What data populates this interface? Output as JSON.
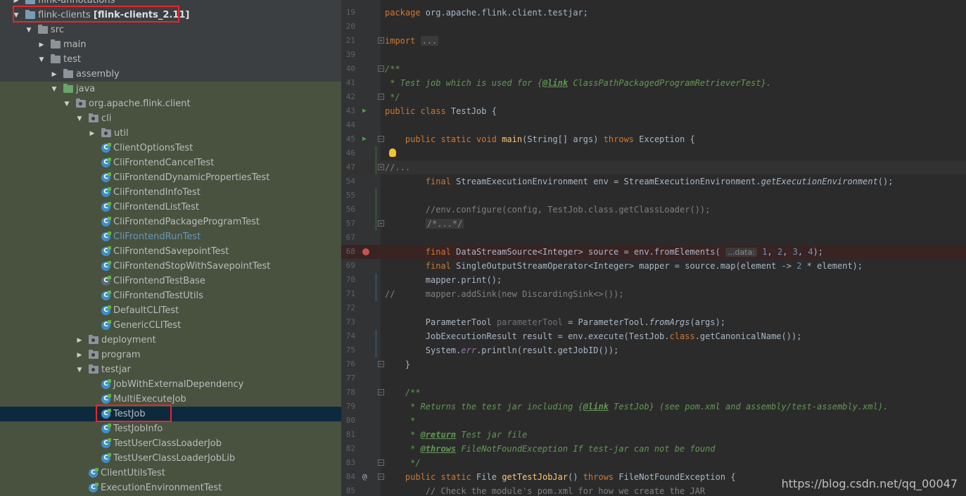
{
  "tree": {
    "items": [
      {
        "label": "flink-annotations",
        "depth": 1,
        "kind": "module",
        "arrow": "right"
      },
      {
        "label": "flink-clients ",
        "suffix": "[flink-clients_2.11]",
        "depth": 1,
        "kind": "module",
        "arrow": "down"
      },
      {
        "label": "src",
        "depth": 2,
        "kind": "folder",
        "arrow": "down"
      },
      {
        "label": "main",
        "depth": 3,
        "kind": "folder",
        "arrow": "right"
      },
      {
        "label": "test",
        "depth": 3,
        "kind": "folder",
        "arrow": "down"
      },
      {
        "label": "assembly",
        "depth": 4,
        "kind": "folder",
        "arrow": "right"
      },
      {
        "label": "java",
        "depth": 4,
        "kind": "testsrc",
        "arrow": "down"
      },
      {
        "label": "org.apache.flink.client",
        "depth": 5,
        "kind": "pkg",
        "arrow": "down"
      },
      {
        "label": "cli",
        "depth": 6,
        "kind": "pkg",
        "arrow": "down"
      },
      {
        "label": "util",
        "depth": 7,
        "kind": "pkg",
        "arrow": "right"
      },
      {
        "label": "ClientOptionsTest",
        "depth": 7,
        "kind": "class",
        "arrow": "none"
      },
      {
        "label": "CliFrontendCancelTest",
        "depth": 7,
        "kind": "class",
        "arrow": "none"
      },
      {
        "label": "CliFrontendDynamicPropertiesTest",
        "depth": 7,
        "kind": "class",
        "arrow": "none"
      },
      {
        "label": "CliFrontendInfoTest",
        "depth": 7,
        "kind": "class",
        "arrow": "none"
      },
      {
        "label": "CliFrontendListTest",
        "depth": 7,
        "kind": "class",
        "arrow": "none"
      },
      {
        "label": "CliFrontendPackageProgramTest",
        "depth": 7,
        "kind": "class",
        "arrow": "none"
      },
      {
        "label": "CliFrontendRunTest",
        "depth": 7,
        "kind": "class",
        "arrow": "none",
        "link": true
      },
      {
        "label": "CliFrontendSavepointTest",
        "depth": 7,
        "kind": "class",
        "arrow": "none"
      },
      {
        "label": "CliFrontendStopWithSavepointTest",
        "depth": 7,
        "kind": "class",
        "arrow": "none"
      },
      {
        "label": "CliFrontendTestBase",
        "depth": 7,
        "kind": "abstract",
        "arrow": "none"
      },
      {
        "label": "CliFrontendTestUtils",
        "depth": 7,
        "kind": "class",
        "arrow": "none"
      },
      {
        "label": "DefaultCLITest",
        "depth": 7,
        "kind": "class",
        "arrow": "none"
      },
      {
        "label": "GenericCLITest",
        "depth": 7,
        "kind": "class",
        "arrow": "none"
      },
      {
        "label": "deployment",
        "depth": 6,
        "kind": "pkg",
        "arrow": "right"
      },
      {
        "label": "program",
        "depth": 6,
        "kind": "pkg",
        "arrow": "right"
      },
      {
        "label": "testjar",
        "depth": 6,
        "kind": "pkg",
        "arrow": "down"
      },
      {
        "label": "JobWithExternalDependency",
        "depth": 7,
        "kind": "class",
        "arrow": "none"
      },
      {
        "label": "MultiExecuteJob",
        "depth": 7,
        "kind": "class",
        "arrow": "none"
      },
      {
        "label": "TestJob",
        "depth": 7,
        "kind": "class",
        "arrow": "none",
        "selected": true
      },
      {
        "label": "TestJobInfo",
        "depth": 7,
        "kind": "class",
        "arrow": "none"
      },
      {
        "label": "TestUserClassLoaderJob",
        "depth": 7,
        "kind": "class",
        "arrow": "none"
      },
      {
        "label": "TestUserClassLoaderJobLib",
        "depth": 7,
        "kind": "class",
        "arrow": "none"
      },
      {
        "label": "ClientUtilsTest",
        "depth": 6,
        "kind": "class",
        "arrow": "none"
      },
      {
        "label": "ExecutionEnvironmentTest",
        "depth": 6,
        "kind": "class",
        "arrow": "none"
      }
    ]
  },
  "editor": {
    "lines": [
      {
        "n": "19",
        "html": "<span class=\"kw\">package</span> org.apache.flink.client.testjar;"
      },
      {
        "n": "20",
        "html": ""
      },
      {
        "n": "21",
        "html": "<span class=\"kw\">import</span> <span class=\"folded\">...</span>",
        "fold": "+"
      },
      {
        "n": "39",
        "html": ""
      },
      {
        "n": "40",
        "html": "<span class=\"doc\">/**</span>",
        "fold": "-"
      },
      {
        "n": "41",
        "html": "<span class=\"doc\"> * Test job which is used for {</span><span class=\"doctag\">@link</span><span class=\"doc\"> ClassPathPackagedProgramRetrieverTest}.</span>"
      },
      {
        "n": "42",
        "html": "<span class=\"doc\"> */</span>",
        "fold": "-"
      },
      {
        "n": "43",
        "html": "<span class=\"kw\">public class</span> TestJob {",
        "run": true
      },
      {
        "n": "44",
        "html": ""
      },
      {
        "n": "45",
        "html": "    <span class=\"kw\">public static void</span> <span class=\"fn\">main</span>(String[] args) <span class=\"kw\">throws</span> Exception {",
        "run": true,
        "fold": "-"
      },
      {
        "n": "46",
        "html": "",
        "bulb": true,
        "change": "add"
      },
      {
        "n": "47",
        "html": "<span class=\"cm\">//...</span>",
        "fold": "+",
        "caret": true,
        "change": "add"
      },
      {
        "n": "54",
        "html": "        <span class=\"kw\">final</span> StreamExecutionEnvironment env = StreamExecutionEnvironment.<span class=\"it\">getExecutionEnvironment</span>();"
      },
      {
        "n": "55",
        "html": "",
        "change": "add"
      },
      {
        "n": "56",
        "html": "        <span class=\"cm\">//env.configure(config, TestJob.class.getClassLoader());</span>",
        "change": "add"
      },
      {
        "n": "57",
        "html": "        <span class=\"folded cm\">/*...*/</span>",
        "fold": "+",
        "change": "add"
      },
      {
        "n": "67",
        "html": ""
      },
      {
        "n": "68",
        "html": "        <span class=\"kw\">final</span> DataStreamSource&lt;Integer&gt; source = env.fromElements( <span class=\"hint\">...data:</span> <span class=\"num-lit\">1</span>, <span class=\"num-lit\">2</span>, <span class=\"num-lit\">3</span>, <span class=\"num-lit\">4</span>);",
        "bp": true
      },
      {
        "n": "69",
        "html": "        <span class=\"kw\">final</span> SingleOutputStreamOperator&lt;Integer&gt; mapper = source.map(element -&gt; <span class=\"num-lit\">2</span> * element);"
      },
      {
        "n": "70",
        "html": "        mapper.print();",
        "change": "mod"
      },
      {
        "n": "71",
        "html": "<span class=\"cm\">//      mapper.addSink(new DiscardingSink&lt;&gt;());</span>",
        "change": "mod"
      },
      {
        "n": "72",
        "html": ""
      },
      {
        "n": "73",
        "html": "        ParameterTool <span class=\"unused\">parameterTool</span> = ParameterTool.<span class=\"it\">fromArgs</span>(args);"
      },
      {
        "n": "74",
        "html": "        JobExecutionResult result = env.execute(TestJob.<span class=\"kw\">class</span>.getCanonicalName());",
        "change": "mod"
      },
      {
        "n": "75",
        "html": "        System.<span class=\"field\">err</span>.println(result.getJobID());",
        "change": "mod"
      },
      {
        "n": "76",
        "html": "    }",
        "fold": "-"
      },
      {
        "n": "77",
        "html": ""
      },
      {
        "n": "78",
        "html": "    <span class=\"doc\">/**</span>",
        "fold": "-"
      },
      {
        "n": "79",
        "html": "<span class=\"doc\">     * Returns the test jar including {</span><span class=\"doctag\">@link</span><span class=\"doc\"> TestJob} (see pom.xml and assembly/test-assembly.xml).</span>"
      },
      {
        "n": "80",
        "html": "<span class=\"doc\">     *</span>"
      },
      {
        "n": "81",
        "html": "<span class=\"doc\">     * </span><span class=\"doctag\">@return</span><span class=\"doc\"> Test jar file</span>"
      },
      {
        "n": "82",
        "html": "<span class=\"doc\">     * </span><span class=\"doctag\">@throws</span><span class=\"doc\"> FileNotFoundException If test-jar can not be found</span>"
      },
      {
        "n": "83",
        "html": "<span class=\"doc\">     */</span>",
        "fold": "-"
      },
      {
        "n": "84",
        "html": "    <span class=\"kw\">public static</span> File <span class=\"fn\">getTestJobJar</span>() <span class=\"kw\">throws</span> FileNotFoundException {",
        "at": true,
        "fold": "-"
      },
      {
        "n": "85",
        "html": "        <span class=\"cm\">// Check the module's pom.xml for how we create the JAR</span>"
      }
    ]
  },
  "watermark": "https://blog.csdn.net/qq_00047"
}
